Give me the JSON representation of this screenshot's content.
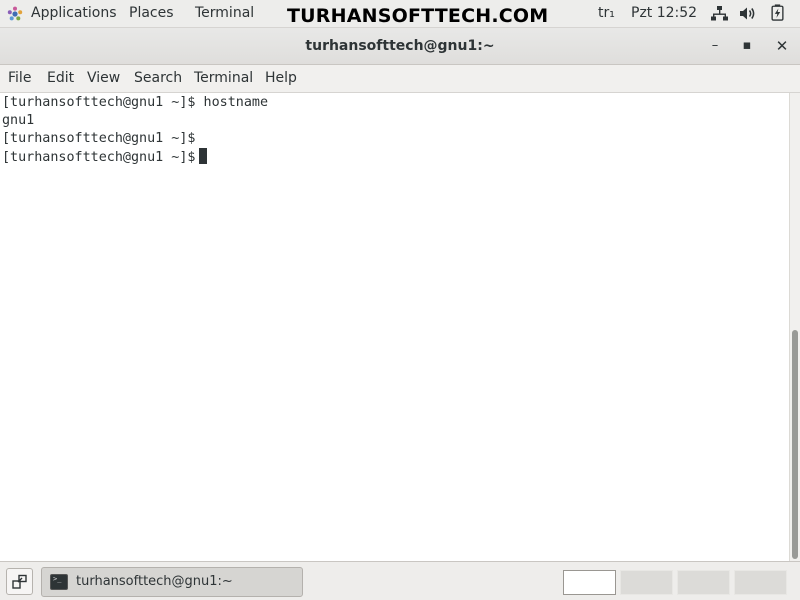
{
  "topbar": {
    "applications_label": "Applications",
    "places_label": "Places",
    "terminal_label": "Terminal",
    "watermark": "TURHANSOFTTECH.COM",
    "language": "tr₁",
    "clock": "Pzt 12:52",
    "icons": [
      "gnome-foot-icon",
      "network-icon",
      "volume-icon",
      "battery-icon"
    ]
  },
  "window": {
    "title": "turhansofttech@gnu1:~",
    "minimize_label": "–",
    "maximize_label": "▪",
    "close_label": "✕"
  },
  "menubar": {
    "items": [
      "File",
      "Edit",
      "View",
      "Search",
      "Terminal",
      "Help"
    ]
  },
  "terminal": {
    "lines": [
      "[turhansofttech@gnu1 ~]$ hostname",
      "gnu1",
      "[turhansofttech@gnu1 ~]$",
      "[turhansofttech@gnu1 ~]$"
    ]
  },
  "taskbar": {
    "task_label": "turhansofttech@gnu1:~",
    "task_icon_glyph": ">_",
    "workspaces": 4,
    "active_workspace": 1
  },
  "colors": {
    "accent_text": "#2e3436",
    "terminal_bg": "#ffffff",
    "panel_bg": "#ededeb"
  }
}
